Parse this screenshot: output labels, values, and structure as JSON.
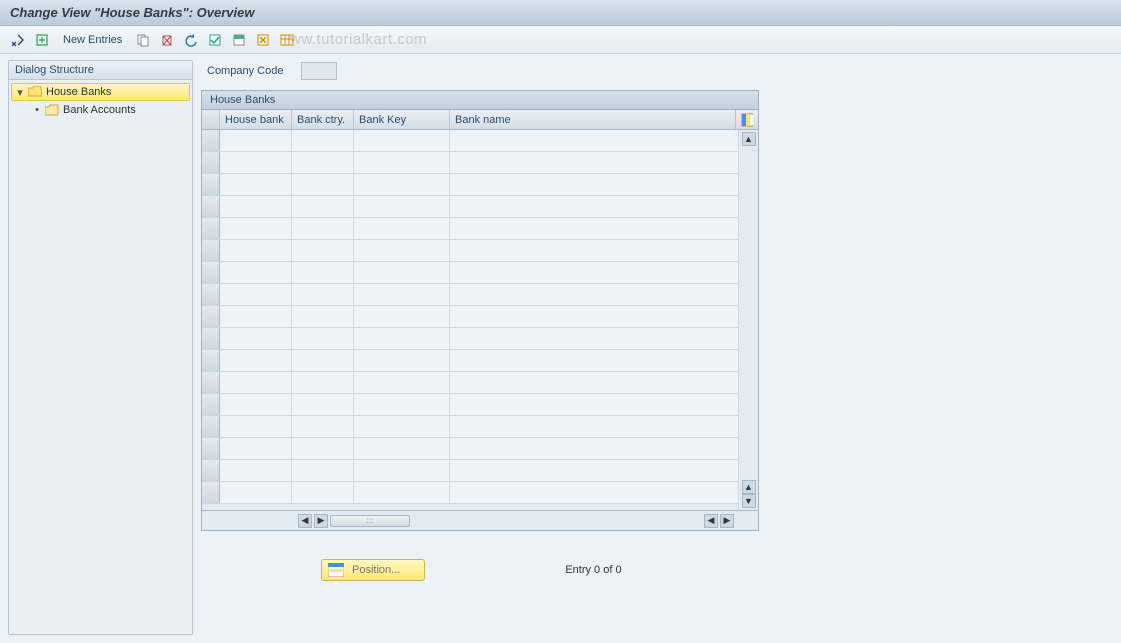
{
  "title": "Change View \"House Banks\": Overview",
  "toolbar": {
    "new_entries_label": "New Entries"
  },
  "watermark": "ww.tutorialkart.com",
  "sidebar": {
    "header": "Dialog Structure",
    "items": [
      {
        "label": "House Banks",
        "selected": true,
        "open": true
      },
      {
        "label": "Bank Accounts",
        "selected": false,
        "open": false
      }
    ]
  },
  "form": {
    "company_code_label": "Company Code",
    "company_code_value": ""
  },
  "grid": {
    "title": "House Banks",
    "columns": {
      "house_bank": "House bank",
      "bank_ctry": "Bank ctry.",
      "bank_key": "Bank Key",
      "bank_name": "Bank name"
    },
    "rows": [
      {},
      {},
      {},
      {},
      {},
      {},
      {},
      {},
      {},
      {},
      {},
      {},
      {},
      {},
      {},
      {},
      {}
    ]
  },
  "footer": {
    "position_label": "Position...",
    "status": "Entry 0 of 0"
  }
}
